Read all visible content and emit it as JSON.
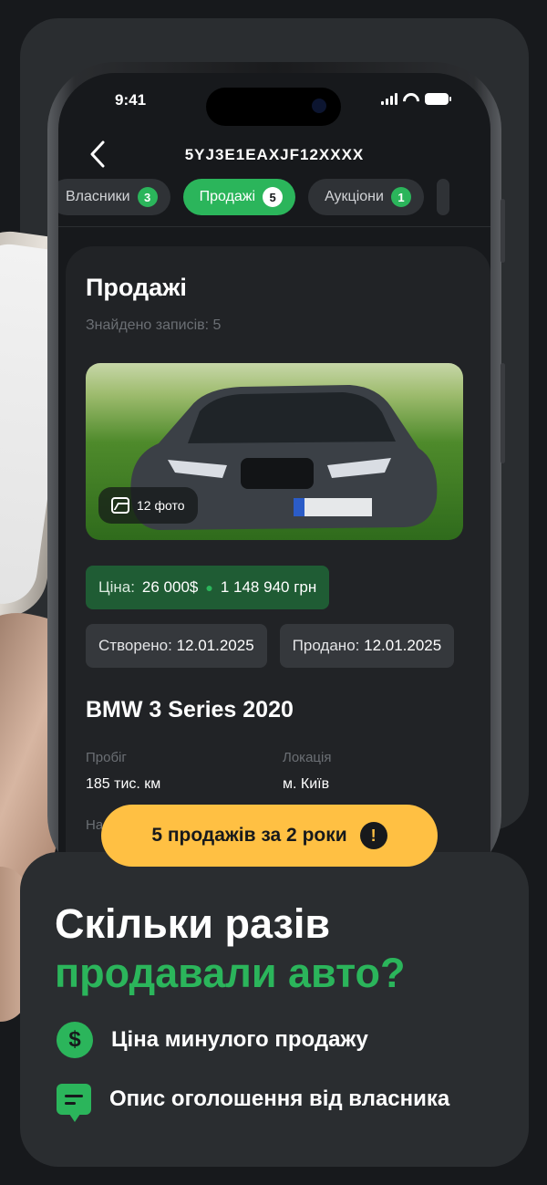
{
  "status_bar": {
    "time": "9:41"
  },
  "navbar": {
    "back_icon": "chevron-left-icon",
    "vin": "5YJ3E1EAXJF12XXXX"
  },
  "tabs": [
    {
      "label": "Власники",
      "count": "3",
      "active": false
    },
    {
      "label": "Продажі",
      "count": "5",
      "active": true
    },
    {
      "label": "Аукціони",
      "count": "1",
      "active": false
    }
  ],
  "sale": {
    "title": "Продажі",
    "found": "Знайдено записів: 5",
    "photo_count": "12 фото",
    "price_label": "Ціна:",
    "price_usd": "26 000$",
    "price_uah": "1 148 940 грн",
    "created_label": "Створено:",
    "created_date": "12.01.2025",
    "sold_label": "Продано:",
    "sold_date": "12.01.2025",
    "model": "BMW 3 Series 2020",
    "mileage_label": "Пробіг",
    "mileage_value": "185 тис. км",
    "location_label": "Локація",
    "location_value": "м. Київ",
    "partial_label": "На"
  },
  "alert": {
    "text": "5 продажів за 2 роки",
    "icon": "exclamation-icon"
  },
  "promo": {
    "headline_white": "Скільки разів",
    "headline_green": "продавали авто?",
    "features": [
      {
        "icon": "dollar-icon",
        "text": "Ціна минулого продажу"
      },
      {
        "icon": "message-icon",
        "text": "Опис оголошення від власника"
      }
    ]
  },
  "colors": {
    "accent": "#2bb55b",
    "alert": "#ffc043",
    "background": "#17191c",
    "card": "#2a2d30"
  }
}
